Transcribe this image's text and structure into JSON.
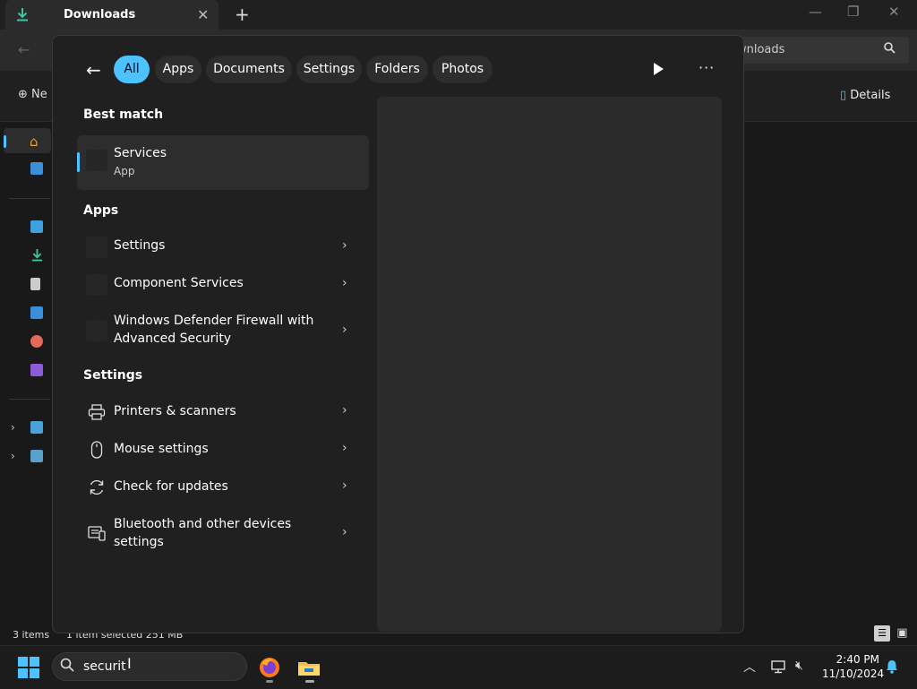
{
  "explorer": {
    "tab_title": "Downloads",
    "search_text_fragment": "wnloads",
    "new_label": "Ne",
    "details_label": "Details",
    "status_items": "3 items",
    "status_selected": "1 item selected  251 MB"
  },
  "search": {
    "filters": [
      "All",
      "Apps",
      "Documents",
      "Settings",
      "Folders",
      "Photos"
    ],
    "active_filter": "All",
    "best_match_header": "Best match",
    "best_match": {
      "title": "Services",
      "subtitle": "App"
    },
    "apps_header": "Apps",
    "apps": [
      {
        "label": "Settings"
      },
      {
        "label": "Component Services"
      },
      {
        "label_line1": "Windows Defender Firewall with",
        "label_line2": "Advanced Security"
      }
    ],
    "settings_header": "Settings",
    "settings": [
      {
        "label": "Printers & scanners",
        "icon": "printer-icon"
      },
      {
        "label": "Mouse settings",
        "icon": "mouse-icon"
      },
      {
        "label": "Check for updates",
        "icon": "refresh-icon"
      },
      {
        "label_line1": "Bluetooth and other devices",
        "label_line2": "settings",
        "icon": "devices-icon"
      }
    ]
  },
  "taskbar": {
    "search_value": "securit",
    "time": "2:40 PM",
    "date": "11/10/2024"
  },
  "colors": {
    "accent": "#4cc2ff",
    "panel": "#202020",
    "card": "#2d2d2d"
  }
}
